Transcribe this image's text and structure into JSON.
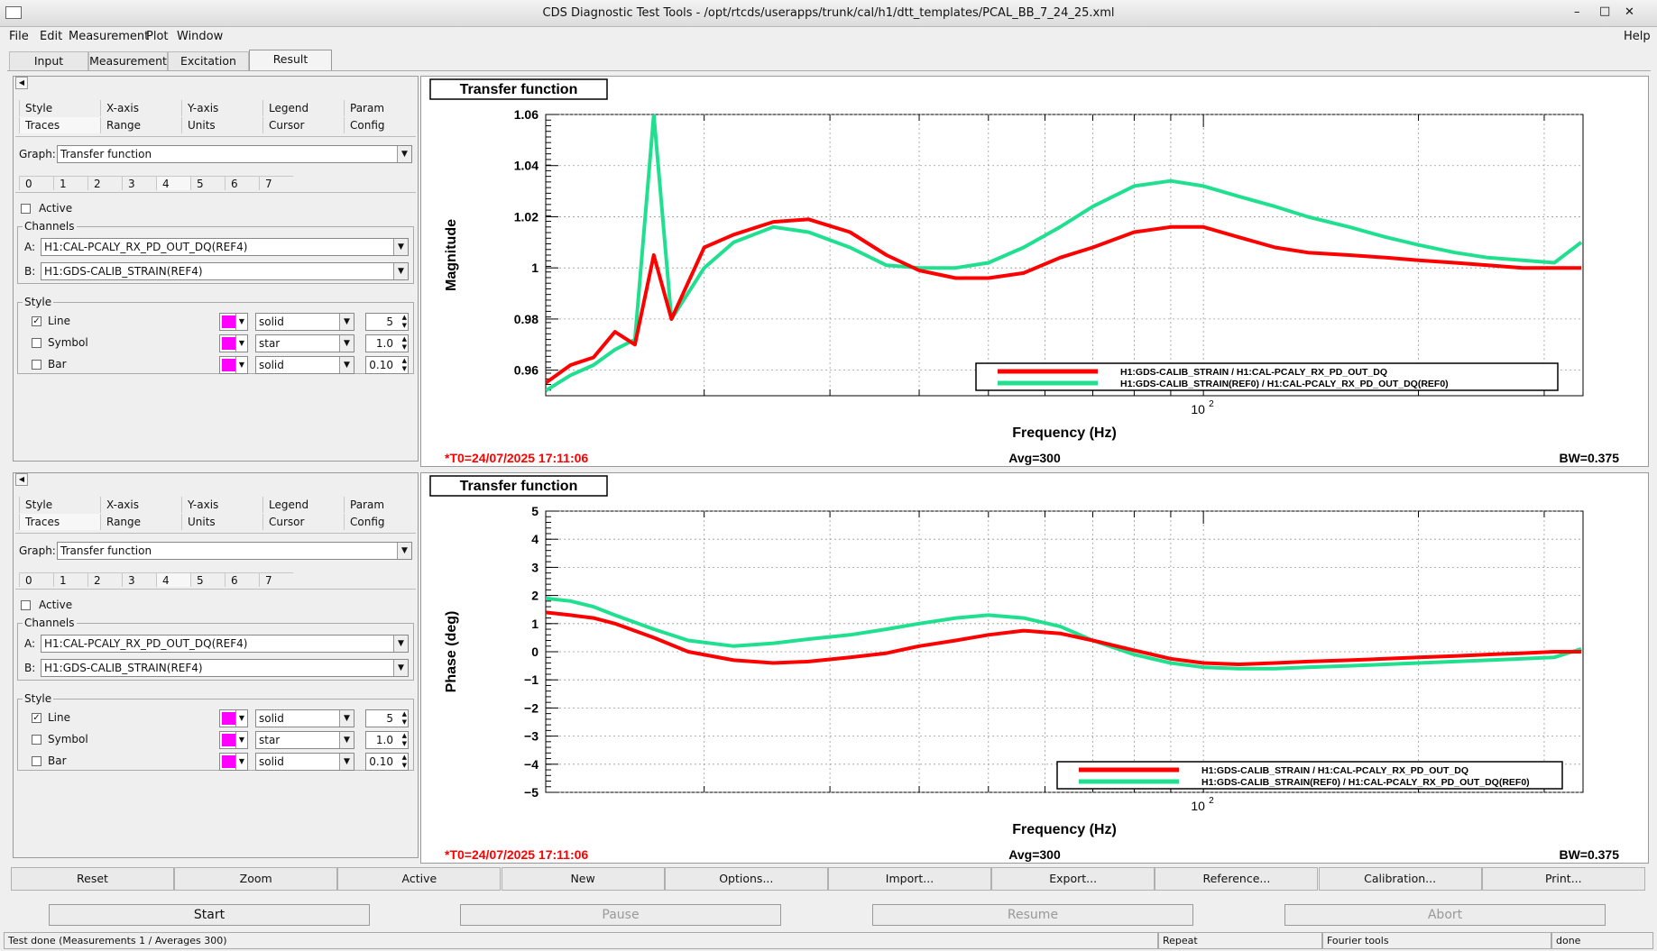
{
  "window": {
    "title": "CDS Diagnostic Test Tools - /opt/rtcds/userapps/trunk/cal/h1/dtt_templates/PCAL_BB_7_24_25.xml",
    "controls": [
      "–",
      "□",
      "✕"
    ]
  },
  "menu": {
    "items": [
      "File",
      "Edit",
      "Measurement",
      "Plot",
      "Window"
    ],
    "help": "Help"
  },
  "tabs": [
    "Input",
    "Measurement",
    "Excitation",
    "Result"
  ],
  "active_tab": "Result",
  "settings_panel": {
    "row1": [
      "Style",
      "X-axis",
      "Y-axis",
      "Legend",
      "Param"
    ],
    "row2": [
      "Traces",
      "Range",
      "Units",
      "Cursor",
      "Config"
    ],
    "graph_label": "Graph:",
    "graph_value": "Transfer function",
    "trace_tabs": [
      "0",
      "1",
      "2",
      "3",
      "4",
      "5",
      "6",
      "7"
    ],
    "active_label": "Active",
    "channels_label": "Channels",
    "a_label": "A:",
    "a_value": "H1:CAL-PCALY_RX_PD_OUT_DQ(REF4)",
    "b_label": "B:",
    "b_value": "H1:GDS-CALIB_STRAIN(REF4)",
    "style_label": "Style",
    "line_label": "Line",
    "symbol_label": "Symbol",
    "bar_label": "Bar",
    "line_style": "solid",
    "symbol_style": "star",
    "bar_style": "solid",
    "line_width": "5",
    "symbol_size": "1.0",
    "bar_width": "0.10",
    "swatch_color": "#ff00ff"
  },
  "plots": [
    {
      "title": "Transfer function",
      "t0": "*T0=24/07/2025 17:11:06",
      "avg": "Avg=300",
      "bw": "BW=0.375"
    },
    {
      "title": "Transfer function",
      "t0": "*T0=24/07/2025 17:11:06",
      "avg": "Avg=300",
      "bw": "BW=0.375"
    }
  ],
  "chart_data": [
    {
      "type": "line",
      "title": "Transfer function",
      "xlabel": "Frequency (Hz)",
      "ylabel": "Magnitude",
      "xscale": "log",
      "xlim": [
        12,
        340
      ],
      "ylim": [
        0.95,
        1.06
      ],
      "yticks": [
        "0.96",
        "0.98",
        "1",
        "1.02",
        "1.04",
        "1.06"
      ],
      "xtick_label": "10",
      "xtick_exp": "2",
      "grid": true,
      "legend_position": "bottom-right",
      "series": [
        {
          "name": "H1:GDS-CALIB_STRAIN / H1:CAL-PCALY_RX_PD_OUT_DQ",
          "color": "#ff0000",
          "x": [
            12,
            13,
            14,
            15,
            16,
            17,
            18,
            20,
            22,
            25,
            28,
            32,
            36,
            40,
            45,
            50,
            56,
            63,
            70,
            80,
            90,
            100,
            112,
            126,
            140,
            160,
            180,
            200,
            225,
            250,
            280,
            310,
            338
          ],
          "y": [
            0.955,
            0.962,
            0.965,
            0.975,
            0.97,
            1.005,
            0.98,
            1.008,
            1.013,
            1.018,
            1.019,
            1.014,
            1.005,
            0.999,
            0.996,
            0.996,
            0.998,
            1.004,
            1.008,
            1.014,
            1.016,
            1.016,
            1.012,
            1.008,
            1.006,
            1.005,
            1.004,
            1.003,
            1.002,
            1.001,
            1.0,
            1.0,
            1.0
          ]
        },
        {
          "name": "H1:GDS-CALIB_STRAIN(REF0) / H1:CAL-PCALY_RX_PD_OUT_DQ(REF0)",
          "color": "#20e090",
          "x": [
            12,
            13,
            14,
            15,
            16,
            17,
            18,
            20,
            22,
            25,
            28,
            32,
            36,
            40,
            45,
            50,
            56,
            63,
            70,
            80,
            90,
            100,
            112,
            126,
            140,
            160,
            180,
            200,
            225,
            250,
            280,
            310,
            338
          ],
          "y": [
            0.952,
            0.958,
            0.962,
            0.968,
            0.972,
            1.06,
            0.98,
            1.0,
            1.01,
            1.016,
            1.014,
            1.008,
            1.001,
            1.0,
            1.0,
            1.002,
            1.008,
            1.016,
            1.024,
            1.032,
            1.034,
            1.032,
            1.028,
            1.024,
            1.02,
            1.016,
            1.012,
            1.009,
            1.006,
            1.004,
            1.003,
            1.002,
            1.01
          ]
        }
      ]
    },
    {
      "type": "line",
      "title": "Transfer function",
      "xlabel": "Frequency (Hz)",
      "ylabel": "Phase (deg)",
      "xscale": "log",
      "xlim": [
        12,
        340
      ],
      "ylim": [
        -5,
        5
      ],
      "yticks": [
        "−5",
        "−4",
        "−3",
        "−2",
        "−1",
        "0",
        "1",
        "2",
        "3",
        "4",
        "5"
      ],
      "xtick_label": "10",
      "xtick_exp": "2",
      "grid": true,
      "legend_position": "bottom-right",
      "series": [
        {
          "name": "H1:GDS-CALIB_STRAIN / H1:CAL-PCALY_RX_PD_OUT_DQ",
          "color": "#ff0000",
          "x": [
            12,
            13,
            14,
            15,
            17,
            19,
            22,
            25,
            28,
            32,
            36,
            40,
            45,
            50,
            56,
            63,
            70,
            80,
            90,
            100,
            112,
            126,
            140,
            160,
            180,
            200,
            225,
            250,
            280,
            310,
            338
          ],
          "y": [
            1.4,
            1.3,
            1.2,
            1.0,
            0.5,
            0.0,
            -0.3,
            -0.4,
            -0.35,
            -0.2,
            -0.05,
            0.2,
            0.4,
            0.6,
            0.75,
            0.65,
            0.4,
            0.05,
            -0.25,
            -0.4,
            -0.45,
            -0.4,
            -0.35,
            -0.3,
            -0.25,
            -0.2,
            -0.15,
            -0.1,
            -0.05,
            0.0,
            0.0
          ]
        },
        {
          "name": "H1:GDS-CALIB_STRAIN(REF0) / H1:CAL-PCALY_RX_PD_OUT_DQ(REF0)",
          "color": "#20e090",
          "x": [
            12,
            13,
            14,
            15,
            17,
            19,
            22,
            25,
            28,
            32,
            36,
            40,
            45,
            50,
            56,
            63,
            70,
            80,
            90,
            100,
            112,
            126,
            140,
            160,
            180,
            200,
            225,
            250,
            280,
            310,
            338
          ],
          "y": [
            1.9,
            1.8,
            1.6,
            1.3,
            0.8,
            0.4,
            0.2,
            0.3,
            0.45,
            0.6,
            0.8,
            1.0,
            1.2,
            1.3,
            1.2,
            0.9,
            0.4,
            -0.1,
            -0.4,
            -0.55,
            -0.6,
            -0.6,
            -0.55,
            -0.5,
            -0.45,
            -0.4,
            -0.35,
            -0.3,
            -0.25,
            -0.2,
            0.1
          ]
        }
      ]
    }
  ],
  "toolbar": [
    "Reset",
    "Zoom",
    "Active",
    "New",
    "Options...",
    "Import...",
    "Export...",
    "Reference...",
    "Calibration...",
    "Print..."
  ],
  "controls": [
    "Start",
    "Pause",
    "Resume",
    "Abort"
  ],
  "status": {
    "main": "Test done (Measurements 1 / Averages 300)",
    "mode": "Repeat",
    "tool": "Fourier tools",
    "state": "done"
  }
}
